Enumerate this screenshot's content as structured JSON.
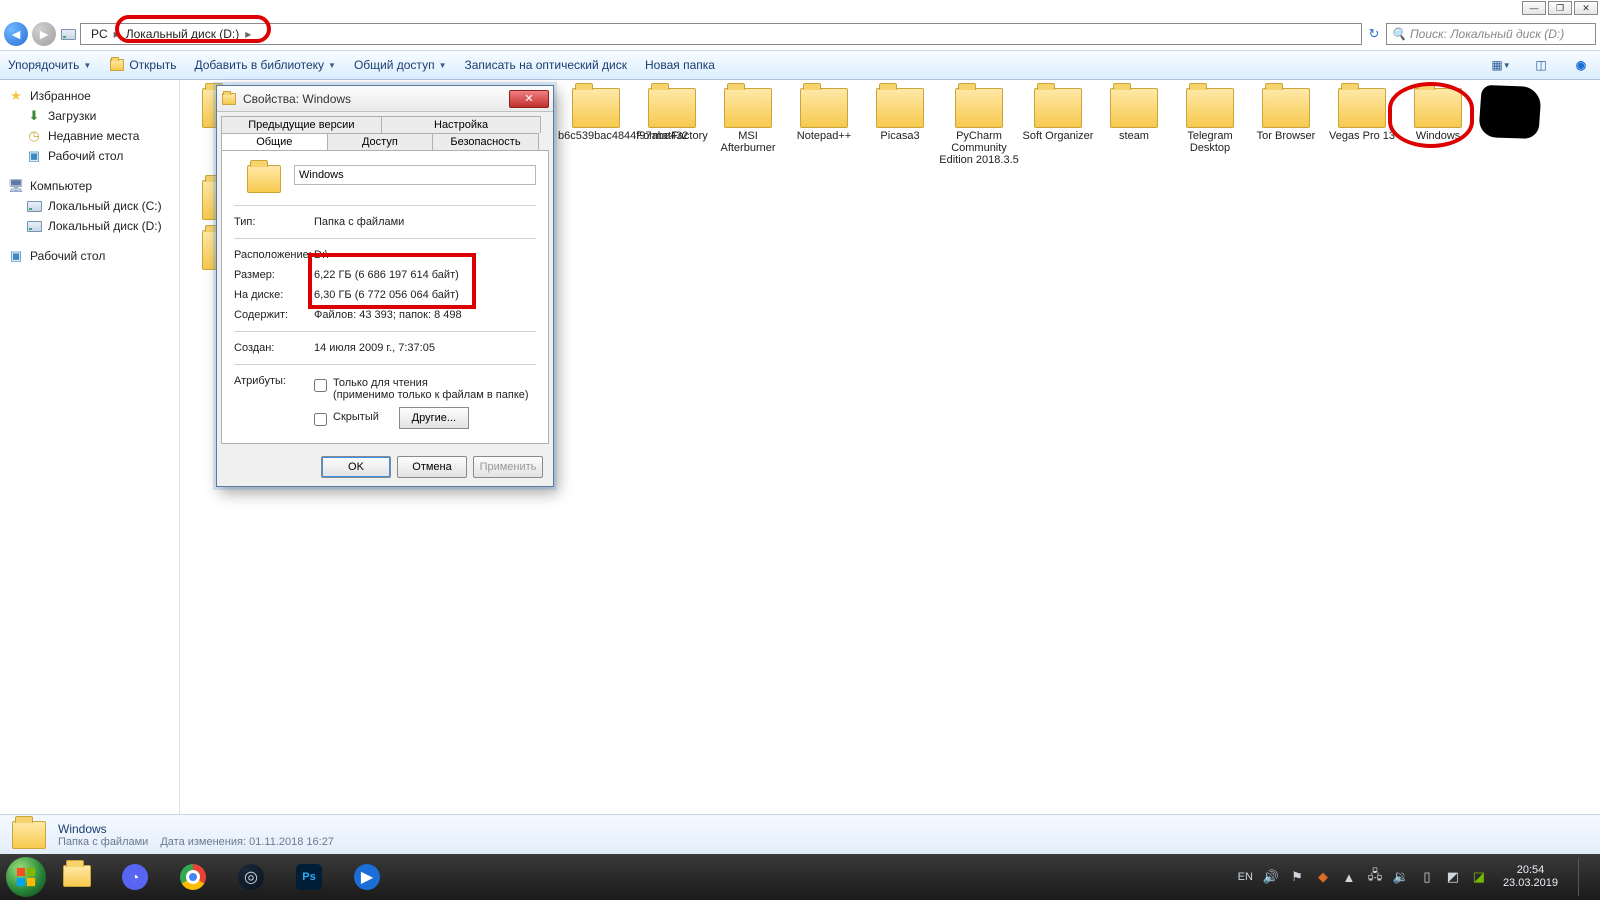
{
  "window_controls": {
    "min": "—",
    "max": "❐",
    "close": "✕"
  },
  "breadcrumbs": {
    "root": "PC",
    "drive": "Локальный диск (D:)",
    "chev": "▸"
  },
  "search": {
    "placeholder": "Поиск: Локальный диск (D:)"
  },
  "toolbar": {
    "organize": "Упорядочить",
    "open": "Открыть",
    "library": "Добавить в библиотеку",
    "share": "Общий доступ",
    "burn": "Записать на оптический диск",
    "newfolder": "Новая папка"
  },
  "tree": {
    "favorites": "Избранное",
    "downloads": "Загрузки",
    "recent": "Недавние места",
    "desktop": "Рабочий стол",
    "computer": "Компьютер",
    "drive_c": "Локальный диск (C:)",
    "drive_d": "Локальный диск (D:)",
    "desktop2": "Рабочий стол"
  },
  "folders": [
    {
      "name": "b6c539bac4844f97abe432"
    },
    {
      "name": "FormatFactory"
    },
    {
      "name": "MSI Afterburner"
    },
    {
      "name": "Notepad++"
    },
    {
      "name": "Picasa3"
    },
    {
      "name": "PyCharm Community Edition 2018.3.5"
    },
    {
      "name": "Soft Organizer"
    },
    {
      "name": "steam"
    },
    {
      "name": "Telegram Desktop"
    },
    {
      "name": "Tor Browser"
    },
    {
      "name": "Vegas Pro 13"
    },
    {
      "name": "Windows"
    }
  ],
  "dialog": {
    "title": "Свойства: Windows",
    "tabs": {
      "prev": "Предыдущие версии",
      "cust": "Настройка",
      "general": "Общие",
      "access": "Доступ",
      "security": "Безопасность"
    },
    "name": "Windows",
    "rows": {
      "type_k": "Тип:",
      "type_v": "Папка с файлами",
      "loc_k": "Расположение:",
      "loc_v": "D:\\",
      "size_k": "Размер:",
      "size_v": "6,22 ГБ (6 686 197 614 байт)",
      "disk_k": "На диске:",
      "disk_v": "6,30 ГБ (6 772 056 064 байт)",
      "cont_k": "Содержит:",
      "cont_v": "Файлов: 43 393; папок: 8 498",
      "created_k": "Создан:",
      "created_v": "14 июля 2009 г., 7:37:05",
      "attr_k": "Атрибуты:",
      "readonly": "Только для чтения",
      "readonly_note": "(применимо только к файлам в папке)",
      "hidden": "Скрытый",
      "other": "Другие..."
    },
    "buttons": {
      "ok": "OK",
      "cancel": "Отмена",
      "apply": "Применить"
    }
  },
  "details": {
    "title": "Windows",
    "subtitle": "Папка с файлами",
    "modified_k": "Дата изменения:",
    "modified_v": "01.11.2018 16:27"
  },
  "tray": {
    "lang": "EN",
    "time": "20:54",
    "date": "23.03.2019"
  }
}
